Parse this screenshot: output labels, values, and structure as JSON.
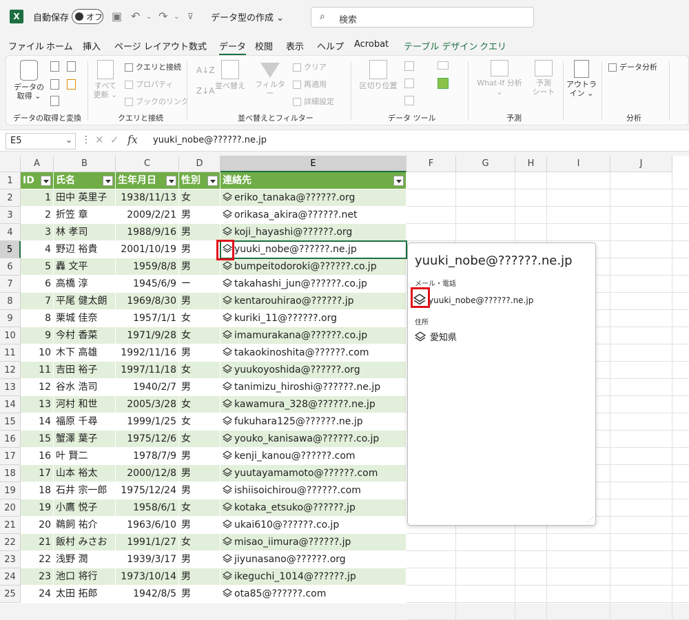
{
  "titlebar": {
    "app_icon": "X",
    "autosave_label": "自動保存",
    "toggle_label": "オフ",
    "doc_title": "データ型の作成",
    "search_placeholder": "検索"
  },
  "menu": [
    "ファイル",
    "ホーム",
    "挿入",
    "ページ レイアウト",
    "数式",
    "データ",
    "校閲",
    "表示",
    "ヘルプ",
    "Acrobat",
    "テーブル デザイン",
    "クエリ"
  ],
  "ribbon": {
    "get_data": "データの\n取得",
    "query_connect": "クエリと接続",
    "properties": "プロパティ",
    "edit_links": "ブックのリンク",
    "refresh_all": "すべて\n更新",
    "sort": "並べ替え",
    "filter": "フィルター",
    "clear": "クリア",
    "reapply": "再適用",
    "advanced": "詳細設定",
    "text_to_columns": "区切り位置",
    "whatif": "What-If 分析",
    "forecast_sheet": "予測\nシート",
    "outline": "アウトラ\nイン",
    "data_analysis": "データ分析",
    "groups": [
      "データの取得と変換",
      "クエリと接続",
      "並べ替えとフィルター",
      "データ ツール",
      "予測",
      "分析"
    ]
  },
  "formula_bar": {
    "name_box": "E5",
    "fx": "fx",
    "value": "yuuki_nobe@??????.ne.jp"
  },
  "columns": [
    "A",
    "B",
    "C",
    "D",
    "E",
    "F",
    "G",
    "H",
    "I",
    "J"
  ],
  "table": {
    "headers": [
      "ID",
      "氏名",
      "生年月日",
      "性別",
      "連絡先"
    ],
    "rows": [
      [
        "1",
        "田中 英里子",
        "1938/11/13",
        "女",
        "eriko_tanaka@??????.org"
      ],
      [
        "2",
        "折笠 章",
        "2009/2/21",
        "男",
        "orikasa_akira@??????.net"
      ],
      [
        "3",
        "林 孝司",
        "1988/9/16",
        "男",
        "koji_hayashi@??????.org"
      ],
      [
        "4",
        "野辺 裕貴",
        "2001/10/19",
        "男",
        "yuuki_nobe@??????.ne.jp"
      ],
      [
        "5",
        "轟 文平",
        "1959/8/8",
        "男",
        "bumpeitodoroki@??????.co.jp"
      ],
      [
        "6",
        "高橋 淳",
        "1945/6/9",
        "ー",
        "takahashi_jun@??????.co.jp"
      ],
      [
        "7",
        "平尾 健太朗",
        "1969/8/30",
        "男",
        "kentarouhirao@??????.jp"
      ],
      [
        "8",
        "栗城 佳奈",
        "1957/1/1",
        "女",
        "kuriki_11@??????.org"
      ],
      [
        "9",
        "今村 香菜",
        "1971/9/28",
        "女",
        "imamurakana@??????.co.jp"
      ],
      [
        "10",
        "木下 高雄",
        "1992/11/16",
        "男",
        "takaokinoshita@??????.com"
      ],
      [
        "11",
        "吉田 裕子",
        "1997/11/18",
        "女",
        "yuukoyoshida@??????.org"
      ],
      [
        "12",
        "谷水 浩司",
        "1940/2/7",
        "男",
        "tanimizu_hiroshi@??????.ne.jp"
      ],
      [
        "13",
        "河村 和世",
        "2005/3/28",
        "女",
        "kawamura_328@??????.ne.jp"
      ],
      [
        "14",
        "福原 千尋",
        "1999/1/25",
        "女",
        "fukuhara125@??????.ne.jp"
      ],
      [
        "15",
        "蟹澤 葉子",
        "1975/12/6",
        "女",
        "youko_kanisawa@??????.co.jp"
      ],
      [
        "16",
        "叶 賢二",
        "1978/7/9",
        "男",
        "kenji_kanou@??????.com"
      ],
      [
        "17",
        "山本 裕太",
        "2000/12/8",
        "男",
        "yuutayamamoto@??????.com"
      ],
      [
        "18",
        "石井 宗一郎",
        "1975/12/24",
        "男",
        "ishiisoichirou@??????.com"
      ],
      [
        "19",
        "小鷹 悦子",
        "1958/6/1",
        "女",
        "kotaka_etsuko@??????.jp"
      ],
      [
        "20",
        "鵜飼 祐介",
        "1963/6/10",
        "男",
        "ukai610@??????.co.jp"
      ],
      [
        "21",
        "飯村 みさお",
        "1991/1/27",
        "女",
        "misao_iimura@??????.jp"
      ],
      [
        "22",
        "浅野 潤",
        "1939/3/17",
        "男",
        "jiyunasano@??????.org"
      ],
      [
        "23",
        "池口 将行",
        "1973/10/14",
        "男",
        "ikeguchi_1014@??????.jp"
      ],
      [
        "24",
        "太田 拓郎",
        "1942/8/5",
        "男",
        "ota85@??????.com"
      ]
    ]
  },
  "card": {
    "title": "yuuki_nobe@??????.ne.jp",
    "section_mail": "メール・電話",
    "mail_value": "yuuki_nobe@??????.ne.jp",
    "section_address": "住所",
    "address_value": "愛知県"
  },
  "colors": {
    "accent": "#1d6f42",
    "table_header": "#70ad47",
    "band": "#e2efda",
    "highlight": "#e0101a"
  }
}
